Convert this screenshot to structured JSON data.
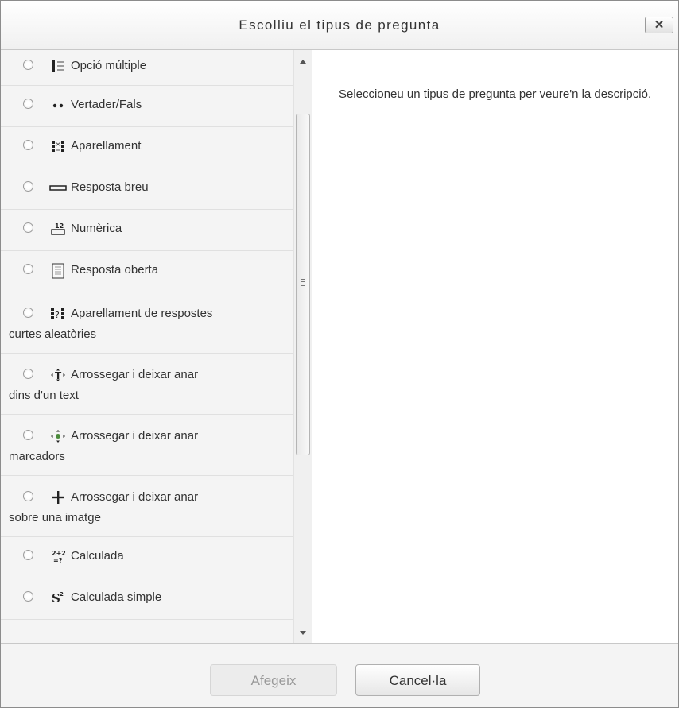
{
  "dialog": {
    "title": "Escolliu el tipus de pregunta",
    "close_label": "✕"
  },
  "options": [
    {
      "label": "Opció múltiple",
      "icon": "multiple-choice-icon"
    },
    {
      "label": "Vertader/Fals",
      "icon": "true-false-icon"
    },
    {
      "label": "Aparellament",
      "icon": "matching-icon"
    },
    {
      "label": "Resposta breu",
      "icon": "short-answer-icon"
    },
    {
      "label": "Numèrica",
      "icon": "numerical-icon"
    },
    {
      "label": "Resposta oberta",
      "icon": "essay-icon"
    },
    {
      "label": "Aparellament de respostes",
      "label_cont": "curtes aleatòries",
      "icon": "random-short-answer-matching-icon"
    },
    {
      "label": "Arrossegar i deixar anar",
      "label_cont": "dins d'un text",
      "icon": "drag-drop-text-icon"
    },
    {
      "label": "Arrossegar i deixar anar",
      "label_cont": "marcadors",
      "icon": "drag-drop-markers-icon"
    },
    {
      "label": "Arrossegar i deixar anar",
      "label_cont": "sobre una imatge",
      "icon": "drag-drop-image-icon"
    },
    {
      "label": "Calculada",
      "icon": "calculated-icon",
      "icon_text": "2+2\n=?"
    },
    {
      "label": "Calculada simple",
      "icon": "calculated-simple-icon"
    }
  ],
  "description": "Seleccioneu un tipus de pregunta per veure'n la descripció.",
  "footer": {
    "add_label": "Afegeix",
    "cancel_label": "Cancel·la"
  }
}
